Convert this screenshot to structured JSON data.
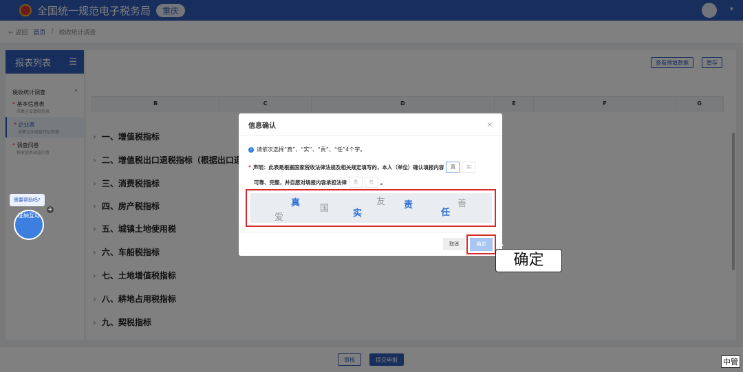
{
  "header": {
    "title": "全国统一规范电子税务局",
    "city": "重庆"
  },
  "breadcrumb": {
    "back": "← 返回",
    "home": "首页",
    "sep": "/",
    "current": "税收统计调查"
  },
  "sidebar": {
    "title": "报表列表",
    "group": "税收统计调查",
    "items": [
      {
        "label": "基本信息表",
        "sub": "采集企业基础信息"
      },
      {
        "label": "企业表",
        "sub": "采集企业经营特征数据"
      },
      {
        "label": "调查问卷",
        "sub": "税收营商调查问卷"
      }
    ]
  },
  "toolbar": {
    "view_prefill": "查看预填数据",
    "save": "暂存"
  },
  "table": {
    "columns": [
      "B",
      "C",
      "D",
      "E",
      "F",
      "G"
    ]
  },
  "sections": [
    "一、增值税指标",
    "二、增值税出口退税指标（根据出口退（",
    "三、消费税指标",
    "四、房产税指标",
    "五、城镇土地使用税",
    "六、车船税指标",
    "七、土地增值税指标",
    "八、耕地占用税指标",
    "九、契税指标"
  ],
  "bottom": {
    "review": "审核",
    "submit": "提交申报"
  },
  "helper": {
    "bubble": "需要帮助吗?",
    "mascot": "征纳互动"
  },
  "dialog": {
    "title": "信息确认",
    "close": "×",
    "tip": "请依次选择“真”、“实”、“责”、“任”4个字。",
    "decl_star": "*",
    "decl1": "声明：此表是根据国家税收法律法规及相关规定填写的，本人（单位）确认填报内容",
    "decl2": "可靠、完整，并自愿对填报内容承担法律",
    "decl_end": "。",
    "slots": [
      "真",
      "实",
      "责",
      "任"
    ],
    "captcha": [
      "爱",
      "真",
      "国",
      "实",
      "友",
      "责",
      "任",
      "善"
    ],
    "cancel": "取消",
    "ok": "确定"
  },
  "callout": "确定",
  "watermark": "中管"
}
